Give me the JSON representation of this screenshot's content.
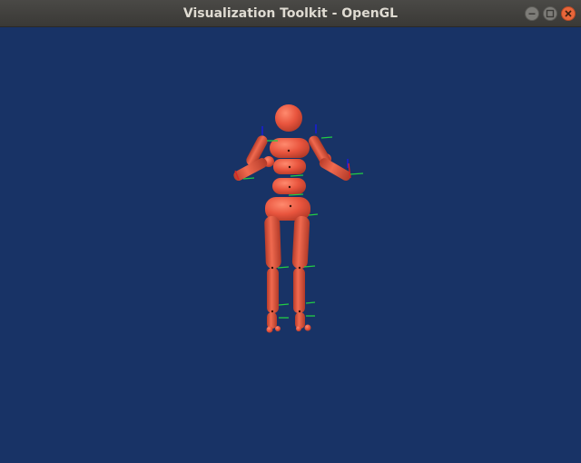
{
  "window": {
    "title": "Visualization Toolkit - OpenGL"
  },
  "titlebar_buttons": [
    {
      "name": "minimize",
      "icon": "minimize-icon"
    },
    {
      "name": "maximize",
      "icon": "maximize-icon"
    },
    {
      "name": "close",
      "icon": "close-icon"
    }
  ],
  "colors": {
    "background": "#183366",
    "body_segments": "#e8543d",
    "axis_green": "#22cc44",
    "axis_blue": "#1a1aee",
    "axis_red": "#dd2222",
    "close_button": "#e9663a"
  }
}
